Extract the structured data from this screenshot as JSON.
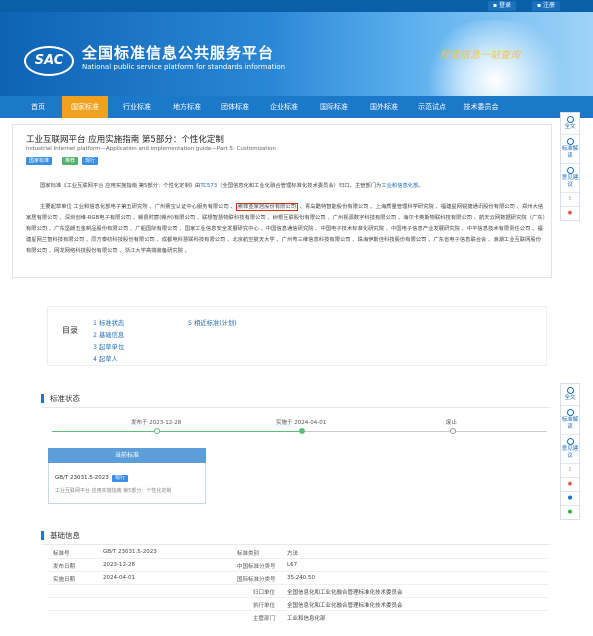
{
  "topbar": {
    "login": "登录",
    "register": "注册"
  },
  "header": {
    "logo": "SAC",
    "title": "全国标准信息公共服务平台",
    "subtitle": "National public service platform  for standards information",
    "slogan": "标准信息一站查询"
  },
  "nav": [
    "首页",
    "国家标准",
    "行业标准",
    "地方标准",
    "团体标准",
    "企业标准",
    "国际标准",
    "国外标准",
    "示范试点",
    "技术委员会"
  ],
  "standard": {
    "title": "工业互联网平台 应用实施指南 第5部分：个性化定制",
    "title_en": "Industrial Internet platform—Application and implementation guide—Part 5: Customization",
    "tags": [
      "国家标准",
      "推荐",
      "现行"
    ],
    "intro_prefix": "国家标准《工业互联网平台 应用实施指南 第5部分：个性化定制》由",
    "tc": "TC573",
    "intro_middle": "（全国信息化和工业化融合管理标准化技术委员会）归口，主管部门为",
    "dept": "工业和信息化部",
    "intro_suffix": "。",
    "drafters_prefix": "主要起草单位 工业和信息化部电子第五研究所 、广州赛宝认证中心服务有限公司 、",
    "drafters_highlight": "索菲亚家居股份有限公司",
    "drafters_rest": " 、青岛酷特智能股份有限公司 、上海质量管理科学研究院 、福建星网锐捷通讯股份有限公司 、郑州大信家居有限公司 、深圳创维-RGB电子有限公司 、赣县时宸(赣州)有限公司 、联想智慧物联科技有限公司 、树根互联股份有限公司 、广州视源数字科技有限公司 、海尔卡奥斯物联科技有限公司 、航天云网数据研究院（广东）有限公司 、广东坚朗五金制品股份有限公司 、广船国际有限公司 、国家工业信息安全发展研究中心 、中国信息通信研究院 、中国电子技术标准化研究院 、中国电子信息产业发展研究院 、中平信息技术有限责任公司 、福建星网兰智科技有限公司 、同方泰纺科技股份有限公司 、成都电科慧联科技有限公司 、北京航空航天大学 、广州粤三维信息科技有限公司 、珠海伊斯佳科技股份有限公司 、广东省电子信息联合会 、浪潮工业互联网股份有限公司 、网龙网络科技股份有限公司 、浙江大学高端装备研究院 。"
  },
  "side_top": [
    {
      "label": "全文"
    },
    {
      "label": "标准解读"
    },
    {
      "label": "意见建议"
    }
  ],
  "side_bottom": [
    {
      "label": "全文"
    },
    {
      "label": "标准解读"
    },
    {
      "label": "意见建议"
    }
  ],
  "toc": {
    "title": "目录",
    "items": [
      "1 标准状态",
      "2 基础信息",
      "3 起草单位",
      "4 起草人",
      "5 相近标准(计划)"
    ]
  },
  "status": {
    "heading": "标准状态",
    "published": "发布于 2023-12-28",
    "implemented": "实施于 2024-04-01",
    "abolished": "废止",
    "current_label": "当前标准",
    "code": "GB/T 23031.5-2023",
    "badge": "现行",
    "desc": "工业互联网平台 应用实施指南 第5部分：个性化定制"
  },
  "basic": {
    "heading": "基础信息",
    "rows": [
      {
        "k1": "标准号",
        "v1": "GB/T 23031.5-2023",
        "k2": "标准类别",
        "v2": "方法"
      },
      {
        "k1": "发布日期",
        "v1": "2023-12-28",
        "k2": "中国标准分类号",
        "v2": "L67"
      },
      {
        "k1": "实施日期",
        "v1": "2024-04-01",
        "k2": "国际标准分类号",
        "v2": "35.240.50"
      }
    ],
    "extra": [
      {
        "k": "归口单位",
        "v": "全国信息化和工业化融合管理标准化技术委员会"
      },
      {
        "k": "执行单位",
        "v": "全国信息化和工业化融合管理标准化技术委员会"
      },
      {
        "k": "主管部门",
        "v": "工业和信息化部"
      }
    ]
  },
  "colors": {
    "primary": "#1c78c9",
    "nav_active": "#f0a21f",
    "link": "#1c6dc0",
    "highlight_border": "#d9301f"
  }
}
